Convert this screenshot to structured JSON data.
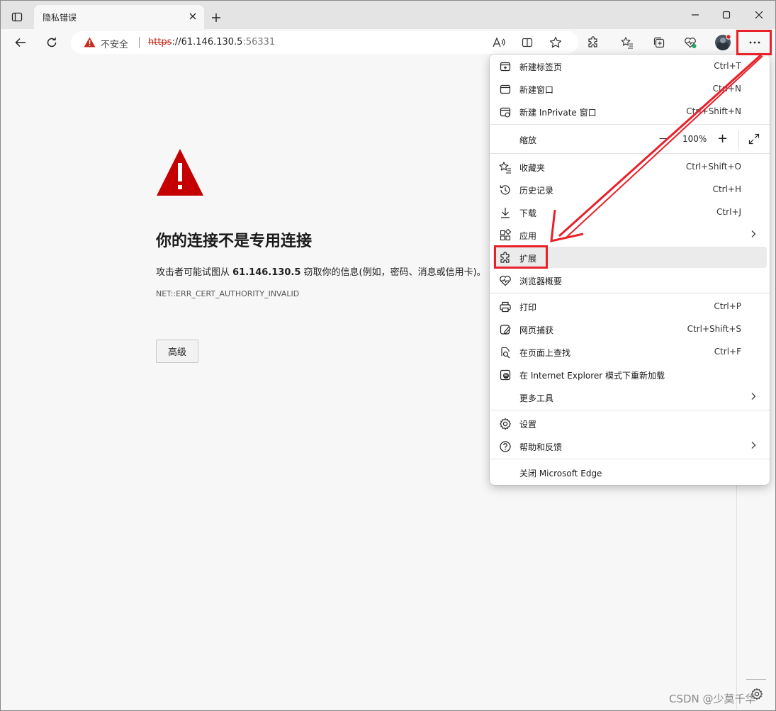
{
  "tab": {
    "title": "隐私错误"
  },
  "address_bar": {
    "security_label": "不安全",
    "url_scheme": "https",
    "url_host": "://61.146.130.5",
    "url_port": ":56331"
  },
  "page": {
    "title": "你的连接不是专用连接",
    "description_prefix": "攻击者可能试图从 ",
    "description_host": "61.146.130.5",
    "description_suffix": " 窃取你的信息(例如，密码、消息或信用卡)。",
    "error_code": "NET::ERR_CERT_AUTHORITY_INVALID",
    "advanced_button": "高级"
  },
  "menu": {
    "new_tab": {
      "label": "新建标签页",
      "shortcut": "Ctrl+T"
    },
    "new_window": {
      "label": "新建窗口",
      "shortcut": "Ctrl+N"
    },
    "new_inprivate": {
      "label": "新建 InPrivate 窗口",
      "shortcut": "Ctrl+Shift+N"
    },
    "zoom": {
      "label": "缩放",
      "value": "100%",
      "minus": "—",
      "plus": "+"
    },
    "favorites": {
      "label": "收藏夹",
      "shortcut": "Ctrl+Shift+O"
    },
    "history": {
      "label": "历史记录",
      "shortcut": "Ctrl+H"
    },
    "downloads": {
      "label": "下载",
      "shortcut": "Ctrl+J"
    },
    "apps": {
      "label": "应用"
    },
    "extensions": {
      "label": "扩展"
    },
    "browser_essentials": {
      "label": "浏览器概要"
    },
    "print": {
      "label": "打印",
      "shortcut": "Ctrl+P"
    },
    "web_capture": {
      "label": "网页捕获",
      "shortcut": "Ctrl+Shift+S"
    },
    "find": {
      "label": "在页面上查找",
      "shortcut": "Ctrl+F"
    },
    "ie_mode": {
      "label": "在 Internet Explorer 模式下重新加载"
    },
    "more_tools": {
      "label": "更多工具"
    },
    "settings": {
      "label": "设置"
    },
    "help": {
      "label": "帮助和反馈"
    },
    "close_edge": {
      "label": "关闭 Microsoft Edge"
    }
  },
  "watermark": "CSDN @少莫千华",
  "colors": {
    "warning_red": "#c50000",
    "annotation_red": "#e8202a",
    "insecure_red": "#c42b1c"
  },
  "icons": [
    "tab-actions-icon",
    "close-icon",
    "plus-icon",
    "minimize-icon",
    "maximize-icon",
    "back-icon",
    "refresh-icon",
    "warning-icon",
    "read-aloud-icon",
    "split-screen-icon",
    "favorite-star-icon",
    "extensions-icon",
    "favorites-icon",
    "collections-icon",
    "browser-essentials-icon",
    "avatar",
    "more-icon",
    "gear-icon"
  ]
}
